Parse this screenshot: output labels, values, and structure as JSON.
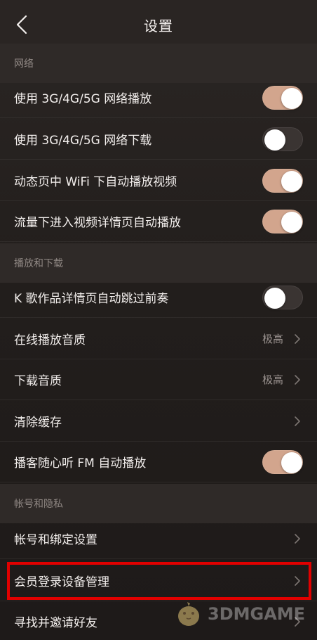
{
  "header": {
    "title": "设置",
    "back_icon": "chevron-left-icon"
  },
  "sections": {
    "network": "网络",
    "play_download": "播放和下载",
    "account_privacy": "帐号和隐私"
  },
  "rows": [
    {
      "label": "使用 3G/4G/5G 网络播放",
      "type": "toggle",
      "on": true
    },
    {
      "label": "使用 3G/4G/5G 网络下载",
      "type": "toggle",
      "on": false
    },
    {
      "label": "动态页中 WiFi 下自动播放视频",
      "type": "toggle",
      "on": true
    },
    {
      "label": "流量下进入视频详情页自动播放",
      "type": "toggle",
      "on": true
    },
    {
      "label": "K 歌作品详情页自动跳过前奏",
      "type": "toggle",
      "on": false
    },
    {
      "label": "在线播放音质",
      "type": "link",
      "value": "极高"
    },
    {
      "label": "下载音质",
      "type": "link",
      "value": "极高"
    },
    {
      "label": "清除缓存",
      "type": "link",
      "value": ""
    },
    {
      "label": "播客随心听 FM 自动播放",
      "type": "toggle",
      "on": true
    },
    {
      "label": "帐号和绑定设置",
      "type": "link",
      "value": ""
    },
    {
      "label": "会员登录设备管理",
      "type": "link",
      "value": "",
      "highlighted": true
    },
    {
      "label": "寻找并邀请好友",
      "type": "link",
      "value": ""
    }
  ],
  "watermark": {
    "text": "3DMGAME",
    "icon": "mascot-bird-icon"
  },
  "colors": {
    "toggle_on": "#d2a58d",
    "toggle_off": "#3a3432",
    "highlight": "#e10000"
  }
}
